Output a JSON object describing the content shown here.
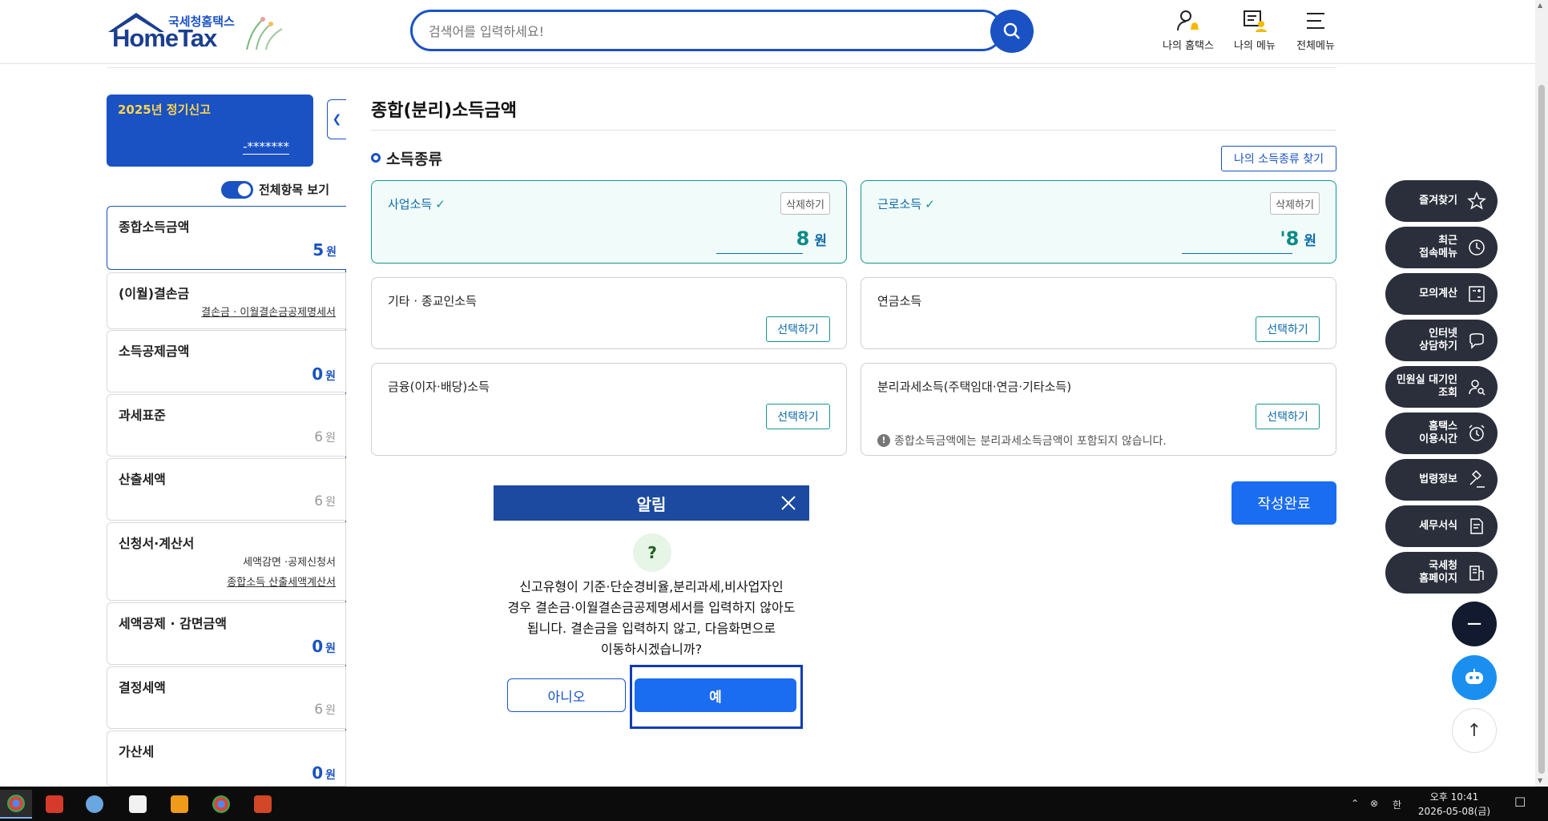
{
  "header": {
    "logo_top": "국세청홈택스",
    "logo_main": "HomeTax",
    "search_placeholder": "검색어를 입력하세요!",
    "links": [
      "나의 홈택스",
      "나의 메뉴",
      "전체메뉴"
    ]
  },
  "left": {
    "card_title": "2025년 정기신고",
    "card_masked": "-*******",
    "toggle_label": "전체항목 보기",
    "items": [
      {
        "name": "종합소득금액",
        "value": "5",
        "unit": "원"
      },
      {
        "name": "(이월)결손금",
        "link": "결손금 · 이월결손금공제명세서"
      },
      {
        "name": "소득공제금액",
        "value": "0",
        "unit": "원"
      },
      {
        "name": "과세표준",
        "value": "6",
        "unit": "원"
      },
      {
        "name": "산출세액",
        "value": "6",
        "unit": "원"
      },
      {
        "name": "신청서·계산서",
        "link1": "세액감면 ·공제신청서",
        "link2": "종합소득 산출세액계산서"
      },
      {
        "name": "세액공제 · 감면금액",
        "value": "0",
        "unit": "원"
      },
      {
        "name": "결정세액",
        "value": "6",
        "unit": "원"
      },
      {
        "name": "가산세",
        "value": "0",
        "unit": "원"
      }
    ]
  },
  "main": {
    "title": "종합(분리)소득금액",
    "section": "소득종류",
    "find_button": "나의 소득종류 찾기",
    "cards": [
      {
        "name": "사업소득",
        "check": "✓",
        "delete": "삭제하기",
        "amount": "8",
        "unit": "원"
      },
      {
        "name": "근로소득",
        "check": "✓",
        "delete": "삭제하기",
        "amount": "'8",
        "unit": "원"
      },
      {
        "name": "기타 · 종교인소득",
        "button": "선택하기"
      },
      {
        "name": "연금소득",
        "button": "선택하기"
      },
      {
        "name": "금융(이자·배당)소득",
        "button": "선택하기"
      },
      {
        "name": "분리과세소득(주택임대·연금·기타소득)",
        "button": "선택하기",
        "note": "종합소득금액에는 분리과세소득금액이 포함되지 않습니다."
      }
    ],
    "complete_button": "작성완료"
  },
  "dialog": {
    "title": "알림",
    "icon": "?",
    "message_lines": [
      "신고유형이 기준·단순경비율,분리과세,비사업자인",
      "경우 결손금·이월결손금공제명세서를 입력하지 않아도",
      "됩니다. 결손금을 입력하지 않고, 다음화면으로",
      "이동하시겠습니까?"
    ],
    "no_label": "아니오",
    "yes_label": "예"
  },
  "quick_menu": [
    {
      "label": "즐겨찾기",
      "icon": "star-icon"
    },
    {
      "label1": "최근",
      "label2": "접속메뉴",
      "icon": "clock-icon"
    },
    {
      "label": "모의계산",
      "icon": "calculator-icon"
    },
    {
      "label1": "인터넷",
      "label2": "상담하기",
      "icon": "chat-icon"
    },
    {
      "label1": "민원실 대기인",
      "label2": "조회",
      "icon": "person-search-icon"
    },
    {
      "label1": "홈택스",
      "label2": "이용시간",
      "icon": "alarm-icon"
    },
    {
      "label": "법령정보",
      "icon": "gavel-icon"
    },
    {
      "label": "세무서식",
      "icon": "form-icon"
    },
    {
      "label1": "국세청",
      "label2": "홈페이지",
      "icon": "building-icon"
    }
  ],
  "taskbar": {
    "ime": "한",
    "time_line1": "오후 10:41",
    "time_line2": "2026-05-08(금)"
  },
  "colors": {
    "brand_blue": "#1a52c4",
    "teal": "#14958f",
    "dark": "#2a2f3b"
  }
}
